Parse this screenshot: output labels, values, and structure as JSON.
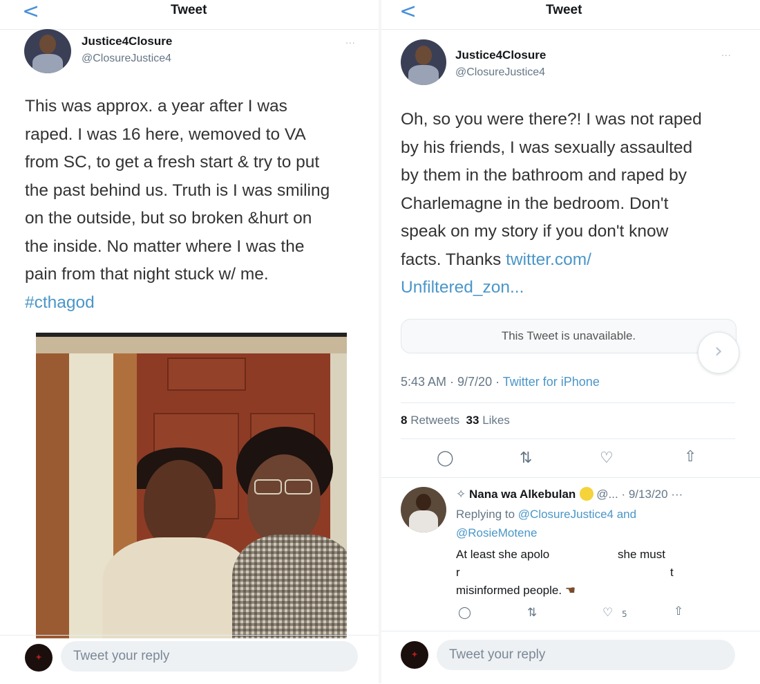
{
  "left": {
    "nav": {
      "back": "<",
      "title": "Tweet"
    },
    "tweet": {
      "name": "Justice4Closure",
      "handle": "@ClosureJustice4",
      "more": "...",
      "text_lines": [
        "This was approx. a year after I was",
        "raped. I was 16 here, wemoved to VA",
        "from SC, to get a fresh start & try to put",
        "the past behind us. Truth is I was smiling",
        "on the outside, but so broken &hurt on",
        "the inside. No matter where I was the",
        "pain from that night stuck w/ me."
      ],
      "hashtag": "#cthagod"
    },
    "reply_placeholder": "Tweet your reply"
  },
  "right": {
    "nav": {
      "back": "<",
      "title": "Tweet"
    },
    "tweet": {
      "name": "Justice4Closure",
      "handle": "@ClosureJustice4",
      "more": "...",
      "text_lines": [
        "Oh, so you were there?! I was not raped",
        "by his friends, I was sexually assaulted",
        "by them in the bathroom and raped by",
        "Charlemagne in the bedroom. Don't",
        "speak on my story if you don't know",
        "facts. Thanks"
      ],
      "link_part1": "twitter.com/",
      "link_part2": "Unfiltered_zon...",
      "quote_unavailable": "This Tweet is unavailable.",
      "time": "5:43 AM · 9/7/20 · ",
      "source": "Twitter for iPhone",
      "retweets_count": "8",
      "retweets_label": "Retweets",
      "likes_count": "33",
      "likes_label": "Likes"
    },
    "reply": {
      "name": "Nana wa Alkebulan",
      "handle_trunc": "@...",
      "date": "· 9/13/20",
      "more": "···",
      "replying_prefix": "Replying to ",
      "replying_to_1": "@ClosureJustice4",
      "replying_and": " and",
      "replying_to_2": "@RosieMotene",
      "line1_a": "At least she apolo",
      "line1_b": "she must",
      "line2_a": "r",
      "line2_b": "t",
      "line3": "misinformed people.",
      "like_count": "5"
    },
    "reply_placeholder": "Tweet your reply"
  },
  "icons": {
    "reply": "comment-icon",
    "retweet": "retweet-icon",
    "like": "heart-icon",
    "share": "share-icon"
  }
}
